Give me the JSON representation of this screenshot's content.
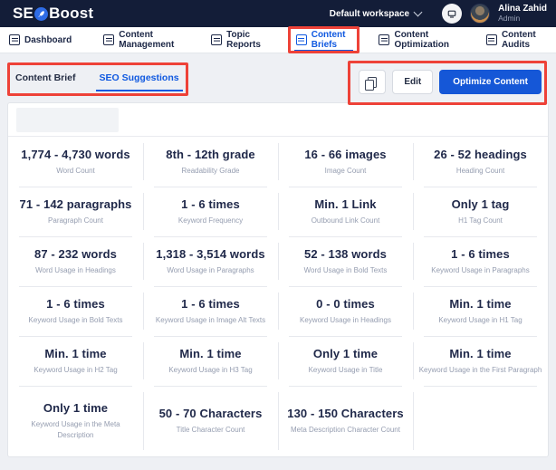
{
  "header": {
    "logo_prefix": "SE",
    "logo_suffix": "Boost",
    "workspace_label": "Default workspace",
    "user": {
      "name": "Alina Zahid",
      "role": "Admin"
    }
  },
  "nav": {
    "items": [
      {
        "label": "Dashboard",
        "icon": "dashboard-icon",
        "active": false,
        "annotated": false
      },
      {
        "label": "Content Management",
        "icon": "content-management-icon",
        "active": false,
        "annotated": false
      },
      {
        "label": "Topic Reports",
        "icon": "topic-reports-icon",
        "active": false,
        "annotated": false
      },
      {
        "label": "Content Briefs",
        "icon": "content-briefs-icon",
        "active": true,
        "annotated": true
      },
      {
        "label": "Content Optimization",
        "icon": "content-optimization-icon",
        "active": false,
        "annotated": false
      },
      {
        "label": "Content Audits",
        "icon": "content-audits-icon",
        "active": false,
        "annotated": false
      }
    ]
  },
  "tabs": {
    "brief_label": "Content Brief",
    "suggestions_label": "SEO Suggestions"
  },
  "actions": {
    "copy_icon": "copy-icon",
    "edit_label": "Edit",
    "optimize_label": "Optimize Content"
  },
  "colors": {
    "header_bg": "#131d38",
    "accent_blue": "#1557d7",
    "nav_active_blue": "#1059e0",
    "annotation_red": "#ee4238",
    "value_text": "#20294a",
    "label_text": "#959db0"
  },
  "metrics": {
    "items": [
      {
        "value": "1,774 - 4,730 words",
        "label": "Word Count"
      },
      {
        "value": "8th - 12th grade",
        "label": "Readability Grade"
      },
      {
        "value": "16 - 66 images",
        "label": "Image Count"
      },
      {
        "value": "26 - 52 headings",
        "label": "Heading Count"
      },
      {
        "value": "71 - 142 paragraphs",
        "label": "Paragraph Count"
      },
      {
        "value": "1 - 6 times",
        "label": "Keyword Frequency"
      },
      {
        "value": "Min. 1 Link",
        "label": "Outbound Link Count"
      },
      {
        "value": "Only 1 tag",
        "label": "H1 Tag Count"
      },
      {
        "value": "87 - 232 words",
        "label": "Word Usage in Headings"
      },
      {
        "value": "1,318 - 3,514 words",
        "label": "Word Usage in Paragraphs"
      },
      {
        "value": "52 - 138 words",
        "label": "Word Usage in Bold Texts"
      },
      {
        "value": "1 - 6 times",
        "label": "Keyword Usage in Paragraphs"
      },
      {
        "value": "1 - 6 times",
        "label": "Keyword Usage in Bold Texts"
      },
      {
        "value": "1 - 6 times",
        "label": "Keyword Usage in Image Alt Texts"
      },
      {
        "value": "0 - 0 times",
        "label": "Keyword Usage in Headings"
      },
      {
        "value": "Min. 1 time",
        "label": "Keyword Usage in H1 Tag"
      },
      {
        "value": "Min. 1 time",
        "label": "Keyword Usage in H2 Tag"
      },
      {
        "value": "Min. 1 time",
        "label": "Keyword Usage in H3 Tag"
      },
      {
        "value": "Only 1 time",
        "label": "Keyword Usage in Title"
      },
      {
        "value": "Min. 1 time",
        "label": "Keyword Usage in the First Paragraph"
      },
      {
        "value": "Only 1 time",
        "label": "Keyword Usage in the Meta Description"
      },
      {
        "value": "50 - 70 Characters",
        "label": "Title Character Count"
      },
      {
        "value": "130 - 150 Characters",
        "label": "Meta Description Character Count"
      }
    ]
  }
}
